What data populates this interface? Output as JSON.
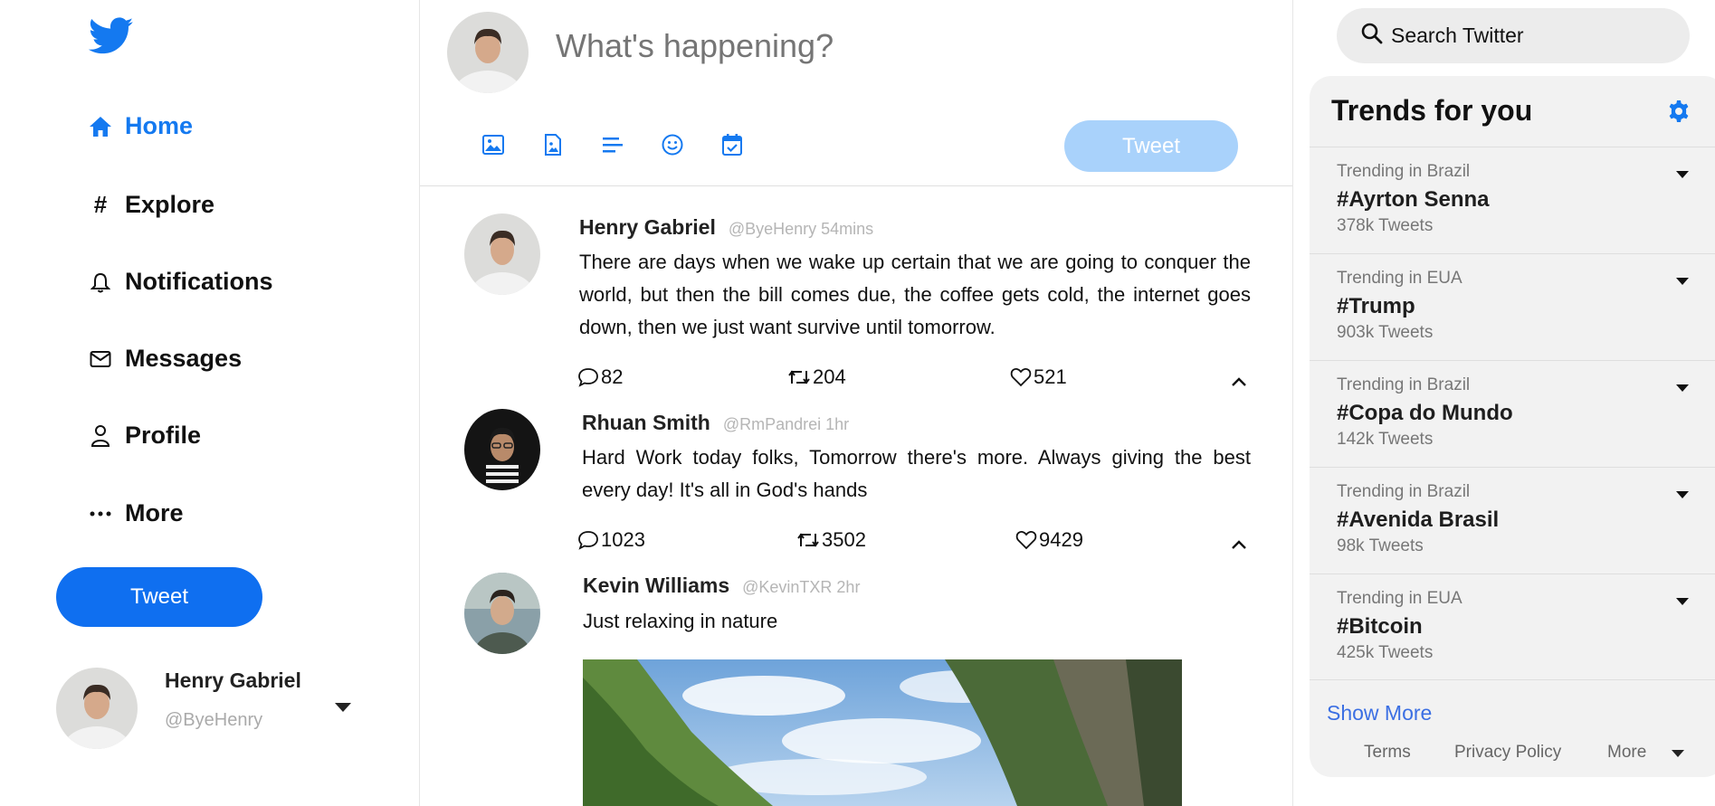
{
  "colors": {
    "accent": "#1479f0",
    "tweet_button": "#0f6ff0",
    "tweet_button_disabled": "#a9d2fb",
    "link": "#3b6fe3"
  },
  "sidebar": {
    "logo_icon": "twitter-bird-icon",
    "items": [
      {
        "label": "Home",
        "icon": "home-icon"
      },
      {
        "label": "Explore",
        "icon": "hashtag-icon"
      },
      {
        "label": "Notifications",
        "icon": "bell-icon"
      },
      {
        "label": "Messages",
        "icon": "envelope-icon"
      },
      {
        "label": "Profile",
        "icon": "user-icon"
      },
      {
        "label": "More",
        "icon": "ellipsis-icon"
      }
    ],
    "tweet_label": "Tweet",
    "account": {
      "name": "Henry Gabriel",
      "handle": "@ByeHenry"
    }
  },
  "compose": {
    "placeholder": "What's happening?",
    "tools": [
      "image-icon",
      "file-image-icon",
      "poll-icon",
      "emoji-icon",
      "schedule-icon"
    ],
    "tweet_label": "Tweet"
  },
  "feed": [
    {
      "name": "Henry Gabriel",
      "handle": "@ByeHenry 54mins",
      "text": "There are days when we wake up certain that we are going to conquer the world, but then the bill comes due, the coffee gets cold, the internet goes down, then we just want survive until tomorrow.",
      "replies": "82",
      "retweets": "204",
      "likes": "521"
    },
    {
      "name": "Rhuan Smith",
      "handle": "@RmPandrei 1hr",
      "text": "Hard Work today folks, Tomorrow there's more. Always giving the best every day! It's all in God's hands",
      "replies": "1023",
      "retweets": "3502",
      "likes": "9429"
    },
    {
      "name": "Kevin Williams",
      "handle": "@KevinTXR 2hr",
      "text": "Just relaxing in nature"
    }
  ],
  "search": {
    "placeholder": "Search Twitter"
  },
  "trends": {
    "title": "Trends for you",
    "items": [
      {
        "location": "Trending in Brazil",
        "tag": "#Ayrton Senna",
        "count": "378k Tweets"
      },
      {
        "location": "Trending in EUA",
        "tag": "#Trump",
        "count": "903k Tweets"
      },
      {
        "location": "Trending in Brazil",
        "tag": "#Copa do Mundo",
        "count": "142k Tweets"
      },
      {
        "location": "Trending in Brazil",
        "tag": "#Avenida Brasil",
        "count": "98k Tweets"
      },
      {
        "location": "Trending in EUA",
        "tag": "#Bitcoin",
        "count": "425k Tweets"
      }
    ],
    "show_more": "Show More",
    "footer": {
      "terms": "Terms",
      "privacy": "Privacy Policy",
      "more": "More"
    }
  }
}
